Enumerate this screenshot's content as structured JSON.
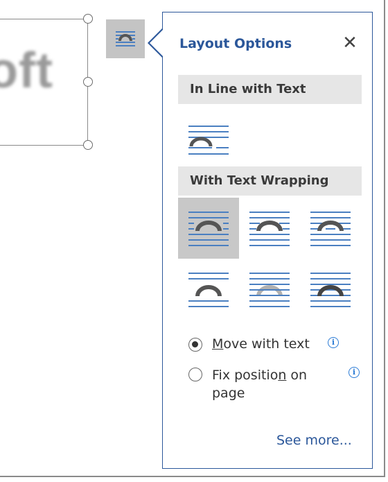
{
  "document": {
    "image_text": "oft"
  },
  "layout_options_button": {
    "icon": "layout-options-icon"
  },
  "panel": {
    "title": "Layout Options",
    "close_icon": "close-icon",
    "close_glyph": "✕",
    "sections": {
      "inline": "In Line with Text",
      "wrapping": "With Text Wrapping"
    },
    "wrap_options": [
      {
        "icon": "in-line-with-text-icon"
      },
      {
        "icon": "square-wrap-icon",
        "selected": true
      },
      {
        "icon": "tight-wrap-icon"
      },
      {
        "icon": "through-wrap-icon"
      },
      {
        "icon": "top-and-bottom-wrap-icon"
      },
      {
        "icon": "behind-text-icon"
      },
      {
        "icon": "in-front-of-text-icon"
      }
    ],
    "radio_move": {
      "prefix": "",
      "underlined": "M",
      "suffix": "ove with text",
      "checked": true
    },
    "radio_fix": {
      "prefix": "Fix positio",
      "underlined": "n",
      "suffix": " on",
      "line2": "page",
      "checked": false
    },
    "info_glyph": "i",
    "see_more": "See more..."
  },
  "colors": {
    "accent": "#2b579a",
    "line_blue": "#4a7fc1",
    "arch_gray": "#555555"
  }
}
